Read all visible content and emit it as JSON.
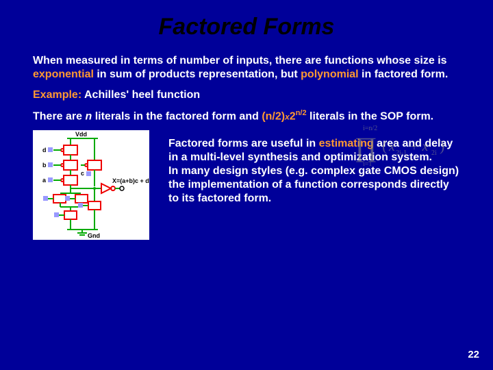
{
  "title": "Factored Forms",
  "p1": {
    "a": "When measured in terms of number of inputs, there are functions whose size is ",
    "exp": "exponential",
    "b": " in sum of products representation, but ",
    "poly": "polynomial",
    "c": " in factored form."
  },
  "example": {
    "label": "Example:",
    "text": " Achilles' heel function"
  },
  "p2": {
    "a": "There are ",
    "n": "n",
    "b": " literals in the factored form and ",
    "frac": "(n/2)",
    "x": "x",
    "two": "2",
    "sup": "n/2",
    "c": " literals in the SOP form."
  },
  "right": {
    "a": "Factored forms are useful in ",
    "est": "estimating",
    "b": " area and delay in a multi-level synthesis and optimization system.",
    "c": "In many design styles (e.g. complex gate CMOS design) the implementation of a function corresponds directly to its factored form."
  },
  "formula": {
    "upper": "i=n/2",
    "lower": "i=1",
    "body_a": "x",
    "body_b": "2i-1",
    "body_c": " + x",
    "body_d": "2i"
  },
  "circuit": {
    "vdd": "Vdd",
    "gnd": "Gnd",
    "d": "d",
    "b": "b",
    "a": "a",
    "c": "c",
    "out": "X=(a+b)c + d"
  },
  "page": "22"
}
